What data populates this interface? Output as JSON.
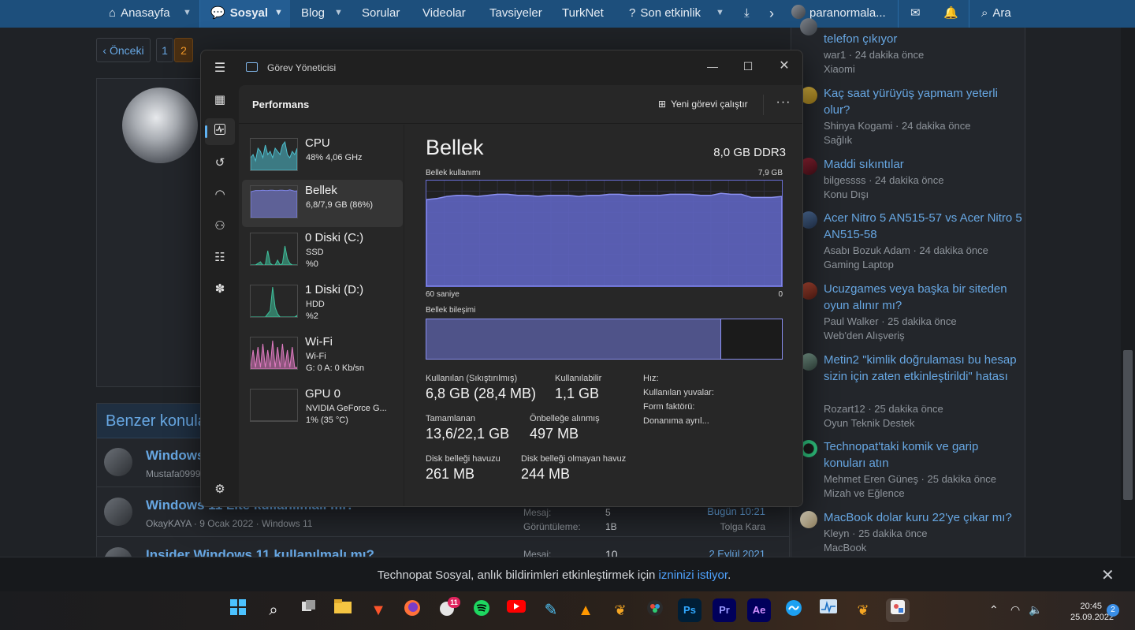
{
  "nav": {
    "items": [
      "Anasayfa",
      "Sosyal",
      "Blog",
      "Sorular",
      "Videolar",
      "Tavsiyeler",
      "TurkNet",
      "Son etkinlik"
    ],
    "user": "paranormala...",
    "search": "Ara"
  },
  "pagination": {
    "prev": "Önceki",
    "pages": [
      "1",
      "2"
    ],
    "current": "2"
  },
  "similar": {
    "title": "Benzer konular",
    "threads": [
      {
        "title": "Windows",
        "meta": "Mustafa0999",
        "k1": "",
        "v1": "",
        "k2": "",
        "v2": "",
        "date": "",
        "user": ""
      },
      {
        "title": "Windows 11 Lite kullanılmalı mı?",
        "meta": "OkayKAYA · 9 Ocak 2022 · Windows 11",
        "k1": "Mesaj:",
        "v1": "5",
        "k2": "Görüntüleme:",
        "v2": "1B",
        "date": "Bugün 10:21",
        "user": "Tolga Kara"
      },
      {
        "title": "Insider Windows 11 kullanılmalı mı?",
        "meta": "",
        "k1": "Mesaj:",
        "v1": "10",
        "k2": "",
        "v2": "",
        "date": "2 Eylül 2021",
        "user": ""
      }
    ]
  },
  "sidebar": {
    "items": [
      {
        "title": "telefon çıkıyor",
        "meta": "war1 · 24 dakika önce",
        "cat": "Xiaomi"
      },
      {
        "title": "Kaç saat yürüyüş yapmam yeterli olur?",
        "meta": "Shinya Kogami · 24 dakika önce",
        "cat": "Sağlık"
      },
      {
        "title": "Maddi sıkıntılar",
        "meta": "bilgessss · 24 dakika önce",
        "cat": "Konu Dışı"
      },
      {
        "title": "Acer Nitro 5 AN515-57 vs Acer Nitro 5 AN515-58",
        "meta": "Asabı Bozuk Adam · 24 dakika önce",
        "cat": "Gaming Laptop"
      },
      {
        "title": "Ucuzgames veya başka bir siteden oyun alınır mı?",
        "meta": "Paul Walker · 25 dakika önce",
        "cat": "Web'den Alışveriş"
      },
      {
        "title": "Metin2 \"kimlik doğrulaması bu hesap sizin için zaten etkinleştirildi\" hatası",
        "meta": "Rozart12 · 25 dakika önce",
        "cat": "Oyun Teknik Destek"
      },
      {
        "title": "Technopat'taki komik ve garip konuları atın",
        "meta": "Mehmet Eren Güneş · 25 dakika önce",
        "cat": "Mizah ve Eğlence"
      },
      {
        "title": "MacBook dolar kuru 22'ye çıkar mı?",
        "meta": "Kleyn · 25 dakika önce",
        "cat": "MacBook"
      }
    ]
  },
  "notification": {
    "text": "Technopat Sosyal, anlık bildirimleri etkinleştirmek için",
    "link": "izninizi istiyor",
    "end": "."
  },
  "taskmanager": {
    "title": "Görev Yöneticisi",
    "section": "Performans",
    "run_new_task": "Yeni görevi çalıştır",
    "devices": [
      {
        "name": "CPU",
        "l1": "48% 4,06 GHz",
        "l2": "",
        "color": "#4ec0cf"
      },
      {
        "name": "Bellek",
        "l1": "6,8/7,9 GB (86%)",
        "l2": "",
        "color": "#7f85e8"
      },
      {
        "name": "0 Diski (C:)",
        "l1": "SSD",
        "l2": "%0",
        "color": "#3fbf9b"
      },
      {
        "name": "1 Diski (D:)",
        "l1": "HDD",
        "l2": "%2",
        "color": "#3fbf9b"
      },
      {
        "name": "Wi-Fi",
        "l1": "Wi-Fi",
        "l2": "G: 0 A: 0 Kb/sn",
        "color": "#e07bc2"
      },
      {
        "name": "GPU 0",
        "l1": "NVIDIA GeForce G...",
        "l2": "1% (35 °C)",
        "color": "#6a6a6a"
      }
    ],
    "memory": {
      "heading": "Bellek",
      "capacity": "8,0 GB DDR3",
      "usage_label": "Bellek kullanımı",
      "usage_max": "7,9 GB",
      "time_label": "60 saniye",
      "time_end": "0",
      "composition_label": "Bellek bileşimi",
      "composition_used_fraction": 0.83,
      "stats": {
        "in_use_label": "Kullanılan (Sıkıştırılmış)",
        "in_use": "6,8 GB (28,4 MB)",
        "available_label": "Kullanılabilir",
        "available": "1,1 GB",
        "committed_label": "Tamamlanan",
        "committed": "13,6/22,1 GB",
        "cached_label": "Önbelleğe alınmış",
        "cached": "497 MB",
        "paged_label": "Disk belleği havuzu",
        "paged": "261 MB",
        "nonpaged_label": "Disk belleği olmayan havuz",
        "nonpaged": "244 MB",
        "speed_label": "Hız:",
        "slots_label": "Kullanılan yuvalar:",
        "form_label": "Form faktörü:",
        "reserved_label": "Donanıma ayrıl..."
      },
      "usage_history": [
        0.82,
        0.83,
        0.85,
        0.86,
        0.86,
        0.85,
        0.86,
        0.87,
        0.87,
        0.86,
        0.86,
        0.85,
        0.86,
        0.86,
        0.86,
        0.85,
        0.86,
        0.86,
        0.87,
        0.87,
        0.86,
        0.86,
        0.86,
        0.86,
        0.87,
        0.87,
        0.87,
        0.86,
        0.86,
        0.88,
        0.87,
        0.87,
        0.84,
        0.84,
        0.84,
        0.85
      ]
    }
  },
  "taskbar": {
    "chat_badge": "11",
    "time": "20:45",
    "date": "25.09.2022",
    "notif_count": "2",
    "apps": [
      "start-icon",
      "search-icon",
      "taskview-icon",
      "explorer-icon",
      "brave-icon",
      "firefox-icon",
      "chat-icon",
      "spotify-icon",
      "youtube-icon",
      "pen-icon",
      "vlc-icon",
      "flstudio-icon",
      "davinci-icon",
      "photoshop-icon",
      "premiere-icon",
      "aftereffects-icon",
      "network-icon",
      "taskmanager-icon",
      "flstudio2-icon",
      "snip-icon"
    ],
    "app_labels": {
      "ps": "Ps",
      "pr": "Pr",
      "ae": "Ae"
    }
  }
}
